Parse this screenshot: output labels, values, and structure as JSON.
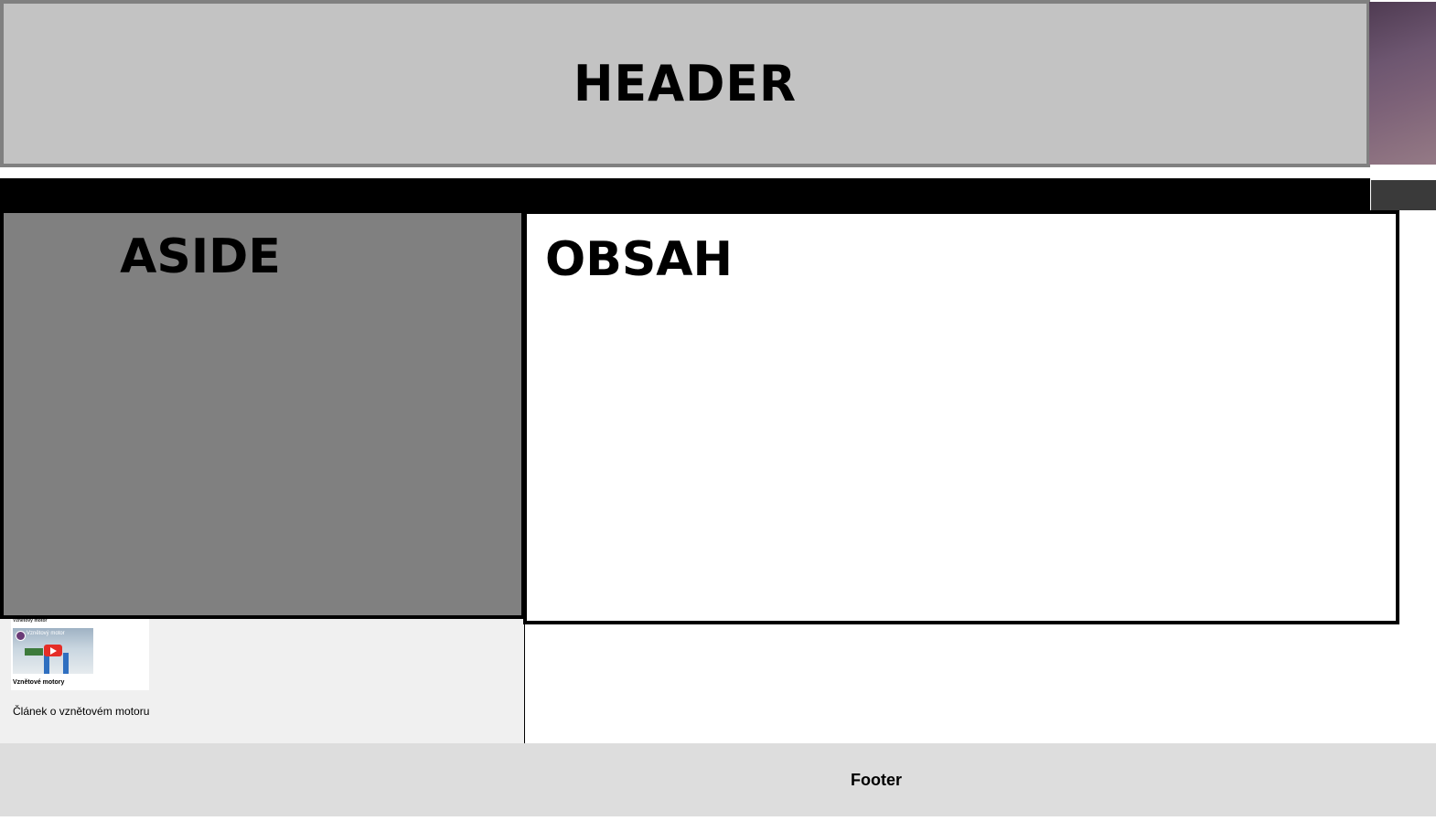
{
  "header": {
    "title": "HEADER"
  },
  "aside": {
    "title": "ASIDE",
    "video": {
      "heading": "Vznětový motor",
      "thumbnail_title": "Vznětový motor",
      "caption": "Vznětové motory"
    },
    "article_link": "Článek o vznětovém motoru"
  },
  "main": {
    "title": "OBSAH"
  },
  "footer": {
    "text": "Footer"
  },
  "colors": {
    "header_bg": "#c3c3c3",
    "aside_bg": "#808080",
    "nav_bg": "#000000",
    "footer_bg": "#dddddd",
    "youtube_red": "#e52d27"
  }
}
